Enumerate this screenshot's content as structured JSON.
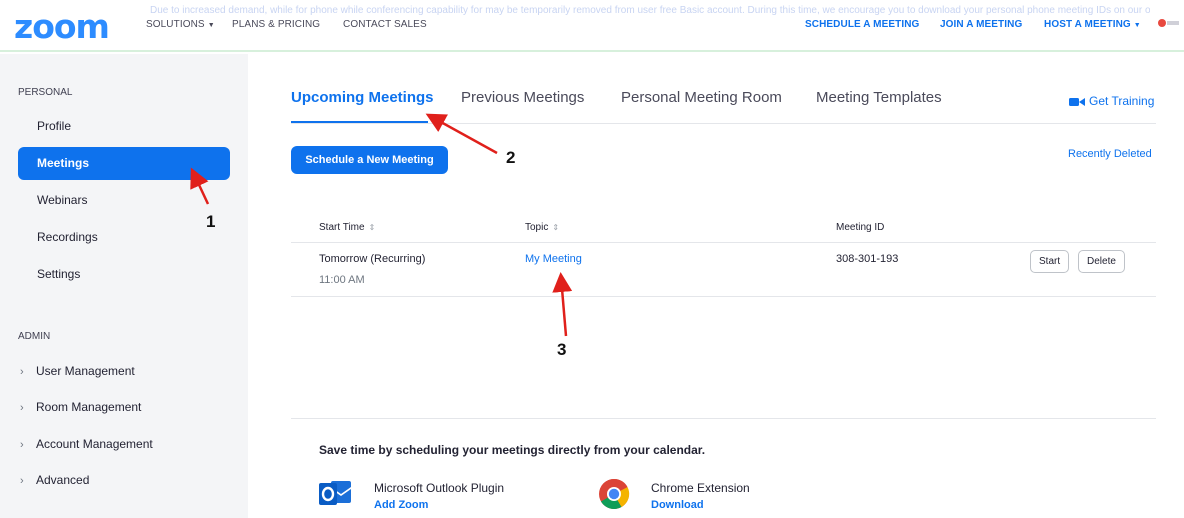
{
  "topnav": {
    "logo": "zoom",
    "faint_banner": "Due to increased demand, while for phone while conferencing capability for may be temporarily removed from user free Basic account. During this time, we encourage you to download your personal phone meeting IDs on our other calling options.",
    "solutions": "SOLUTIONS",
    "plans_pricing": "PLANS & PRICING",
    "contact_sales": "CONTACT SALES",
    "schedule_meeting": "SCHEDULE A MEETING",
    "join_meeting": "JOIN A MEETING",
    "host_meeting": "HOST A MEETING",
    "caret": "▼"
  },
  "sidebar": {
    "personal_heading": "PERSONAL",
    "personal_items": [
      {
        "label": "Profile"
      },
      {
        "label": "Meetings"
      },
      {
        "label": "Webinars"
      },
      {
        "label": "Recordings"
      },
      {
        "label": "Settings"
      }
    ],
    "admin_heading": "ADMIN",
    "admin_items": [
      {
        "label": "User Management"
      },
      {
        "label": "Room Management"
      },
      {
        "label": "Account Management"
      },
      {
        "label": "Advanced"
      }
    ],
    "chevron": "›"
  },
  "main": {
    "tabs": [
      {
        "label": "Upcoming Meetings"
      },
      {
        "label": "Previous Meetings"
      },
      {
        "label": "Personal Meeting Room"
      },
      {
        "label": "Meeting Templates"
      }
    ],
    "get_training": "Get Training",
    "schedule_button": "Schedule a New Meeting",
    "recently_deleted": "Recently Deleted",
    "table": {
      "headers": {
        "start_time": "Start Time",
        "topic": "Topic",
        "meeting_id": "Meeting ID"
      },
      "sort_glyph": "⇕",
      "rows": [
        {
          "start_time": "Tomorrow (Recurring)",
          "time": "11:00 AM",
          "topic": "My Meeting",
          "meeting_id": "308-301-193",
          "start_label": "Start",
          "delete_label": "Delete"
        }
      ]
    },
    "promo": {
      "title": "Save time by scheduling your meetings directly from your calendar.",
      "outlook_name": "Microsoft Outlook Plugin",
      "outlook_link": "Add Zoom",
      "chrome_name": "Chrome Extension",
      "chrome_link": "Download"
    }
  },
  "annotations": [
    "1",
    "2",
    "3"
  ],
  "colors": {
    "accent": "#0e72ed",
    "logo": "#2d8cff",
    "sidebar_bg": "#f4f5f7",
    "arrow": "#e0201b"
  }
}
